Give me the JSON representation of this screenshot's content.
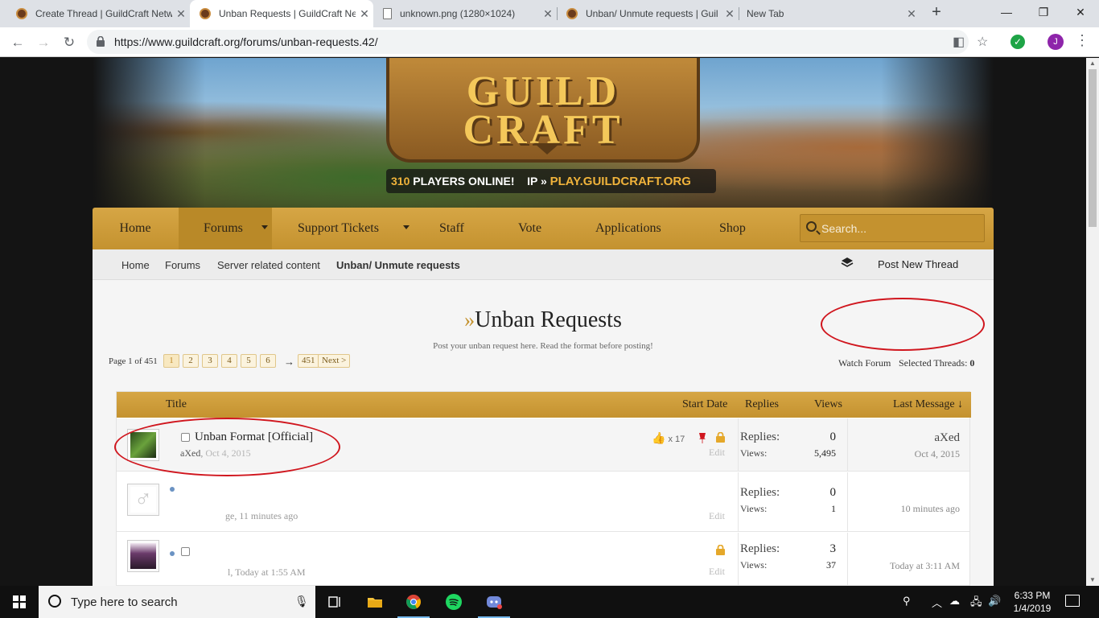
{
  "browser": {
    "tabs": [
      {
        "title": "Create Thread | GuildCraft Netw",
        "icon": "guildcraft-favicon"
      },
      {
        "title": "Unban Requests | GuildCraft Ne",
        "icon": "guildcraft-favicon"
      },
      {
        "title": "unknown.png (1280×1024)",
        "icon": "document-icon"
      },
      {
        "title": "Unban/ Unmute requests | Guil",
        "icon": "guildcraft-favicon"
      },
      {
        "title": "New Tab",
        "icon": ""
      }
    ],
    "url": "https://www.guildcraft.org/forums/unban-requests.42/",
    "profile_initial": "J"
  },
  "banner": {
    "logo_text": "GUILD CRAFT",
    "players_count": "310",
    "players_label": "PLAYERS ONLINE!",
    "ip_label": "IP »",
    "ip_value": "PLAY.GUILDCRAFT.ORG"
  },
  "nav": {
    "items": [
      "Home",
      "Forums",
      "Support Tickets",
      "Staff",
      "Vote",
      "Applications",
      "Shop"
    ],
    "search_placeholder": "Search..."
  },
  "breadcrumbs": [
    "Home",
    "Forums",
    "Server related content",
    "Unban/ Unmute requests"
  ],
  "post_new_thread": "Post New Thread",
  "forum": {
    "title_prefix": "»",
    "title": "Unban Requests",
    "description": "Post your unban request here. Read the format before posting!",
    "page_label": "Page 1 of 451",
    "pages": [
      "1",
      "2",
      "3",
      "4",
      "5",
      "6"
    ],
    "arrow": "→",
    "last_page": "451",
    "next": "Next >",
    "watch": "Watch Forum",
    "selected_label": "Selected Threads:",
    "selected_count": "0"
  },
  "list_headers": {
    "title": "Title",
    "start_date": "Start Date",
    "replies": "Replies",
    "views": "Views",
    "last_message": "Last Message ↓"
  },
  "threads": [
    {
      "title": "Unban Format [Official]",
      "author": "aXed",
      "date": "Oct 4, 2015",
      "likes": "x 17",
      "edit": "Edit",
      "replies_label": "Replies:",
      "replies": "0",
      "views_label": "Views:",
      "views": "5,495",
      "last_user": "aXed",
      "last_date": "Oct 4, 2015"
    },
    {
      "title": "",
      "author": "",
      "date": "ge, 11 minutes ago",
      "edit": "Edit",
      "replies_label": "Replies:",
      "replies": "0",
      "views_label": "Views:",
      "views": "1",
      "last_user": "",
      "last_date": "10 minutes ago"
    },
    {
      "title": "",
      "author": "",
      "date": "l, Today at 1:55 AM",
      "edit": "Edit",
      "replies_label": "Replies:",
      "replies": "3",
      "views_label": "Views:",
      "views": "37",
      "last_user": "",
      "last_date": "Today at 3:11 AM"
    }
  ],
  "taskbar": {
    "search_text": "Type here to search",
    "time": "6:33 PM",
    "date": "1/4/2019"
  },
  "colors": {
    "nav_gold": "#c4922f",
    "accent_red": "#d0161e",
    "tab_bar": "#dee1e6"
  }
}
